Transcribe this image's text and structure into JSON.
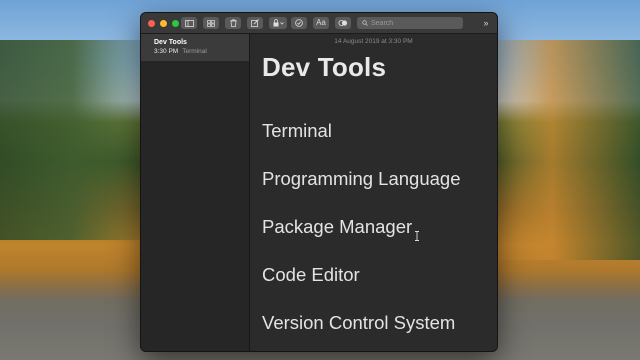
{
  "window": {
    "toolbar": {
      "buttons": [
        {
          "name": "sidebar-toggle-icon"
        },
        {
          "name": "gallery-view-icon"
        },
        {
          "name": "trash-icon"
        },
        {
          "name": "compose-icon"
        },
        {
          "name": "lock-icon"
        },
        {
          "name": "checklist-icon"
        },
        {
          "name": "format-text-icon",
          "label": "Aa"
        },
        {
          "name": "share-icon"
        }
      ],
      "search": {
        "placeholder": "Search"
      },
      "more_label": "»"
    },
    "sidebar": {
      "notes": [
        {
          "title": "Dev Tools",
          "time": "3:30 PM",
          "preview": "Terminal"
        }
      ]
    },
    "editor": {
      "timestamp": "14 August 2019 at 3:30 PM",
      "title": "Dev Tools",
      "lines": [
        "Terminal",
        "Programming Language",
        "Package Manager",
        "Code Editor",
        "Version Control System"
      ]
    }
  },
  "colors": {
    "close": "#ff5f57",
    "minimize": "#febc2e",
    "zoom": "#28c840",
    "window_bg": "#2b2b2b",
    "sidebar_selected": "#3b3b3b"
  }
}
